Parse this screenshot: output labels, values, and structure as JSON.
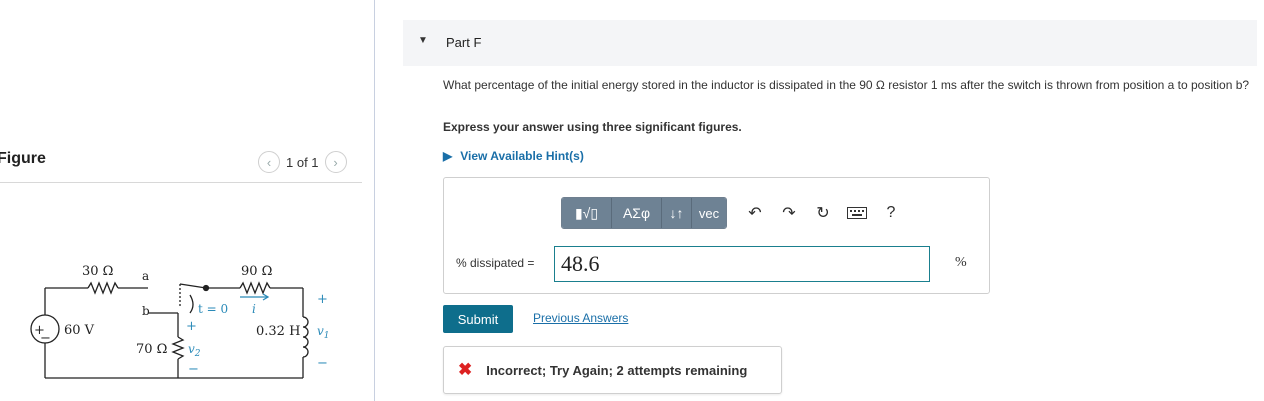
{
  "figure": {
    "title": "Figure",
    "pager": "1 of 1",
    "prev_icon": "chevron-left-icon",
    "next_icon": "chevron-right-icon",
    "circuit": {
      "source": "60 V",
      "source_plus": "+",
      "source_minus": "−",
      "r1": "30 Ω",
      "node_a": "a",
      "node_b": "b",
      "switch_time": "t = 0",
      "r2": "90 Ω",
      "current": "i",
      "r3": "70 Ω",
      "v2": "v",
      "v2_sub": "2",
      "inductor": "0.32 H",
      "v1": "v",
      "v1_sub": "1",
      "plus": "+",
      "minus": "−"
    }
  },
  "part": {
    "caret": "▼",
    "title": "Part F",
    "question_text": "What percentage of the initial energy stored in the inductor is dissipated in the 90 Ω resistor 1 ms after the switch is thrown from position a to position b?",
    "instruction": "Express your answer using three significant figures.",
    "hints_caret": "▶",
    "hints_label": "View Available Hint(s)"
  },
  "toolbar": {
    "templates_label": "▮√▯",
    "greek_label": "ΑΣφ",
    "arrows_label": "↓↑",
    "vec_label": "vec",
    "undo_icon": "undo-icon",
    "redo_icon": "redo-icon",
    "reset_icon": "reset-icon",
    "keyboard_icon": "keyboard-icon",
    "help_label": "?"
  },
  "answer": {
    "label": "% dissipated =",
    "value": "48.6",
    "unit": "%"
  },
  "actions": {
    "submit_label": "Submit",
    "previous_answers_label": "Previous Answers"
  },
  "feedback": {
    "icon": "✖",
    "text": "Incorrect; Try Again; 2 attempts remaining"
  },
  "colors": {
    "accent": "#0e6e8c",
    "link": "#1a6fa8",
    "error": "#dd2222",
    "toolbar": "#6e8294"
  }
}
